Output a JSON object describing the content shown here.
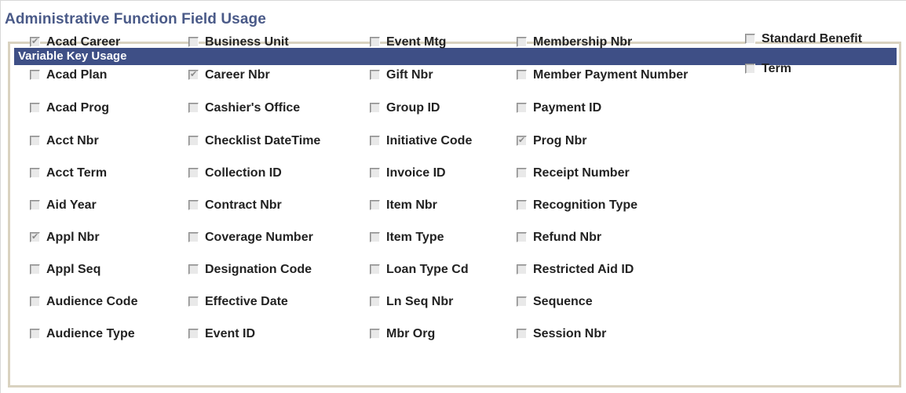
{
  "page": {
    "title": "Administrative Function Field Usage"
  },
  "group": {
    "title": "Variable Key Usage"
  },
  "colors": {
    "title_text": "#4a5a88",
    "header_background": "#3e4f86",
    "header_text": "#ffffff",
    "group_border": "#d9d2c0"
  },
  "columns": [
    {
      "items": [
        {
          "label": "Acad Career",
          "checked": true
        },
        {
          "label": "Acad Plan",
          "checked": false
        },
        {
          "label": "Acad Prog",
          "checked": false
        },
        {
          "label": "Acct Nbr",
          "checked": false
        },
        {
          "label": "Acct Term",
          "checked": false
        },
        {
          "label": "Aid Year",
          "checked": false
        },
        {
          "label": "Appl Nbr",
          "checked": true
        },
        {
          "label": "Appl Seq",
          "checked": false
        },
        {
          "label": "Audience Code",
          "checked": false
        },
        {
          "label": "Audience Type",
          "checked": false
        }
      ]
    },
    {
      "items": [
        {
          "label": "Business Unit",
          "checked": false
        },
        {
          "label": "Career Nbr",
          "checked": true
        },
        {
          "label": "Cashier's Office",
          "checked": false
        },
        {
          "label": "Checklist DateTime",
          "checked": false
        },
        {
          "label": "Collection ID",
          "checked": false
        },
        {
          "label": "Contract Nbr",
          "checked": false
        },
        {
          "label": "Coverage Number",
          "checked": false
        },
        {
          "label": "Designation Code",
          "checked": false
        },
        {
          "label": "Effective Date",
          "checked": false
        },
        {
          "label": "Event ID",
          "checked": false
        }
      ]
    },
    {
      "items": [
        {
          "label": "Event Mtg",
          "checked": false
        },
        {
          "label": "Gift Nbr",
          "checked": false
        },
        {
          "label": "Group ID",
          "checked": false
        },
        {
          "label": "Initiative Code",
          "checked": false
        },
        {
          "label": "Invoice ID",
          "checked": false
        },
        {
          "label": "Item Nbr",
          "checked": false
        },
        {
          "label": "Item Type",
          "checked": false
        },
        {
          "label": "Loan Type Cd",
          "checked": false
        },
        {
          "label": "Ln Seq Nbr",
          "checked": false
        },
        {
          "label": "Mbr Org",
          "checked": false
        }
      ]
    },
    {
      "items": [
        {
          "label": "Membership Nbr",
          "checked": false
        },
        {
          "label": "Member Payment Number",
          "checked": false
        },
        {
          "label": "Payment ID",
          "checked": false
        },
        {
          "label": "Prog Nbr",
          "checked": true
        },
        {
          "label": "Receipt Number",
          "checked": false
        },
        {
          "label": "Recognition Type",
          "checked": false
        },
        {
          "label": "Refund Nbr",
          "checked": false
        },
        {
          "label": "Restricted Aid ID",
          "checked": false
        },
        {
          "label": "Sequence",
          "checked": false
        },
        {
          "label": "Session Nbr",
          "checked": false
        }
      ]
    },
    {
      "items": [
        {
          "label": "Standard Benefit",
          "checked": false
        },
        {
          "label": "Term",
          "checked": false
        }
      ]
    }
  ]
}
